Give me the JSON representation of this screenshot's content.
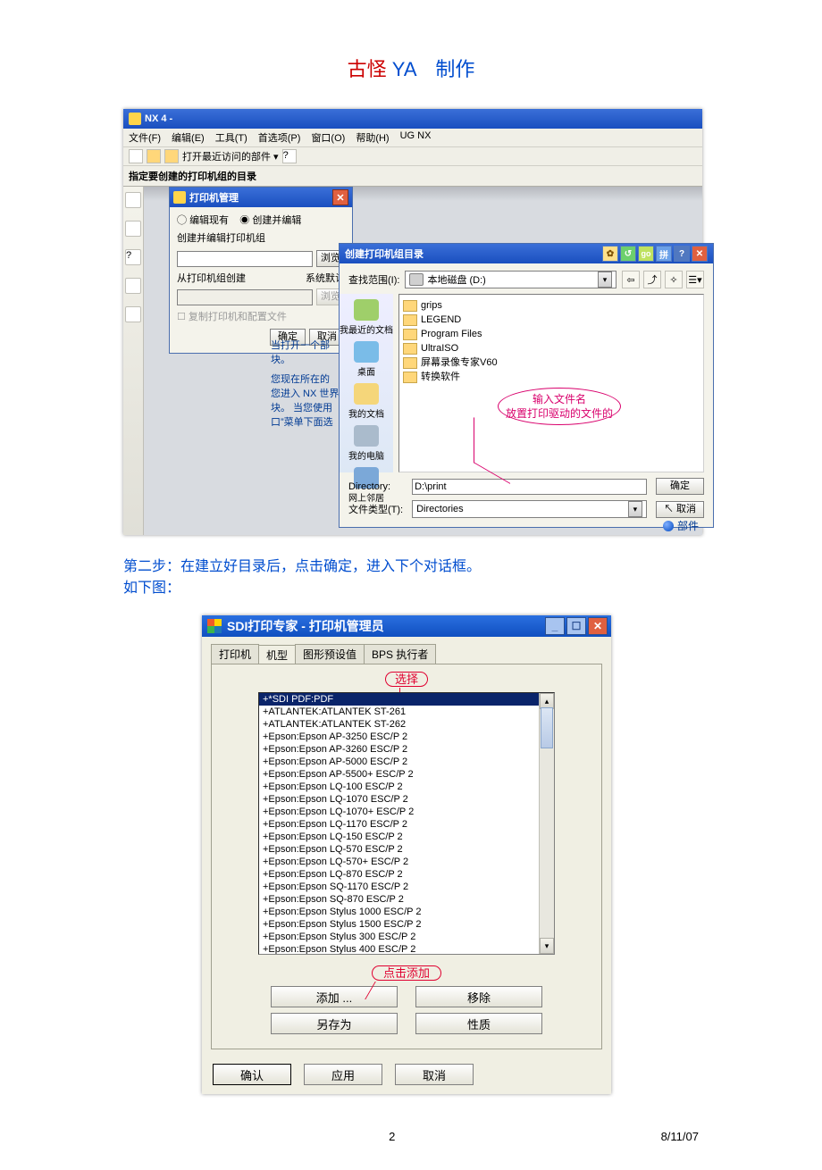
{
  "doc": {
    "header_red": "古怪 ",
    "header_blue1": "YA",
    "header_spacer": "　",
    "header_blue2": "制作",
    "step2_line1": "第二步：在建立好目录后，点击确定，进入下个对话框。",
    "step2_line2": "如下图：",
    "page_number": "2",
    "date": "8/11/07"
  },
  "nx": {
    "title": "NX 4 -",
    "menu": [
      "文件(F)",
      "编辑(E)",
      "工具(T)",
      "首选项(P)",
      "窗口(O)",
      "帮助(H)",
      "UG NX"
    ],
    "toolbar_text": "打开最近访问的部件 ▾",
    "hint": "指定要创建的打印机组的目录",
    "status_part": "部件"
  },
  "dlg1": {
    "title": "打印机管理",
    "radio_edit": "编辑现有",
    "radio_create": "创建并编辑",
    "sub": "创建并编辑打印机组",
    "browse": "浏览",
    "from_label": "从打印机组创建",
    "from_default": "系统默认",
    "browse2": "浏览",
    "copy_chk": "复制打印机和配置文件",
    "ok": "确定",
    "cancel": "取消"
  },
  "help": {
    "l1": "当打开一个部",
    "l2": "块。",
    "l3": "您现在所在的",
    "l4": "您进入 NX 世界",
    "l5": "块。 当您使用",
    "l6": "口”菜单下面选"
  },
  "dlg2": {
    "title": "创建打印机组目录",
    "lookin_label": "查找范围(I):",
    "drive": "本地磁盘 (D:)",
    "places": {
      "recent": "我最近的文档",
      "desktop": "桌面",
      "mydocs": "我的文档",
      "mypc": "我的电脑",
      "network": "网上邻居"
    },
    "folders": [
      "grips",
      "LEGEND",
      "Program Files",
      "UltraISO",
      "屏幕录像专家V60",
      "转换软件"
    ],
    "callout_l1": "输入文件名",
    "callout_l2": "放置打印驱动的文件的",
    "dir_label": "Directory:",
    "dir_value": "D:\\print",
    "type_label": "文件类型(T):",
    "type_value": "Directories",
    "ok": "确定",
    "cancel": "取消"
  },
  "sdi": {
    "title": "SDI打印专家 - 打印机管理员",
    "tabs": [
      "打印机",
      "机型",
      "图形预设值",
      "BPS 执行者"
    ],
    "sel_caption": "选择",
    "list": [
      "+*SDI PDF:PDF",
      "+ATLANTEK:ATLANTEK ST-261",
      "+ATLANTEK:ATLANTEK ST-262",
      "+Epson:Epson AP-3250 ESC/P 2",
      "+Epson:Epson AP-3260 ESC/P 2",
      "+Epson:Epson AP-5000 ESC/P 2",
      "+Epson:Epson AP-5500+ ESC/P 2",
      "+Epson:Epson LQ-100 ESC/P 2",
      "+Epson:Epson LQ-1070 ESC/P 2",
      "+Epson:Epson LQ-1070+ ESC/P 2",
      "+Epson:Epson LQ-1170 ESC/P 2",
      "+Epson:Epson LQ-150 ESC/P 2",
      "+Epson:Epson LQ-570 ESC/P 2",
      "+Epson:Epson LQ-570+ ESC/P 2",
      "+Epson:Epson LQ-870 ESC/P 2",
      "+Epson:Epson SQ-1170 ESC/P 2",
      "+Epson:Epson SQ-870 ESC/P 2",
      "+Epson:Epson Stylus 1000 ESC/P 2",
      "+Epson:Epson Stylus 1500 ESC/P 2",
      "+Epson:Epson Stylus 300 ESC/P 2",
      "+Epson:Epson Stylus 400 ESC/P 2"
    ],
    "add_caption": "点击添加",
    "btn_add": "添加 ...",
    "btn_remove": "移除",
    "btn_saveas": "另存为",
    "btn_props": "性质",
    "btn_ok": "确认",
    "btn_apply": "应用",
    "btn_cancel": "取消"
  }
}
